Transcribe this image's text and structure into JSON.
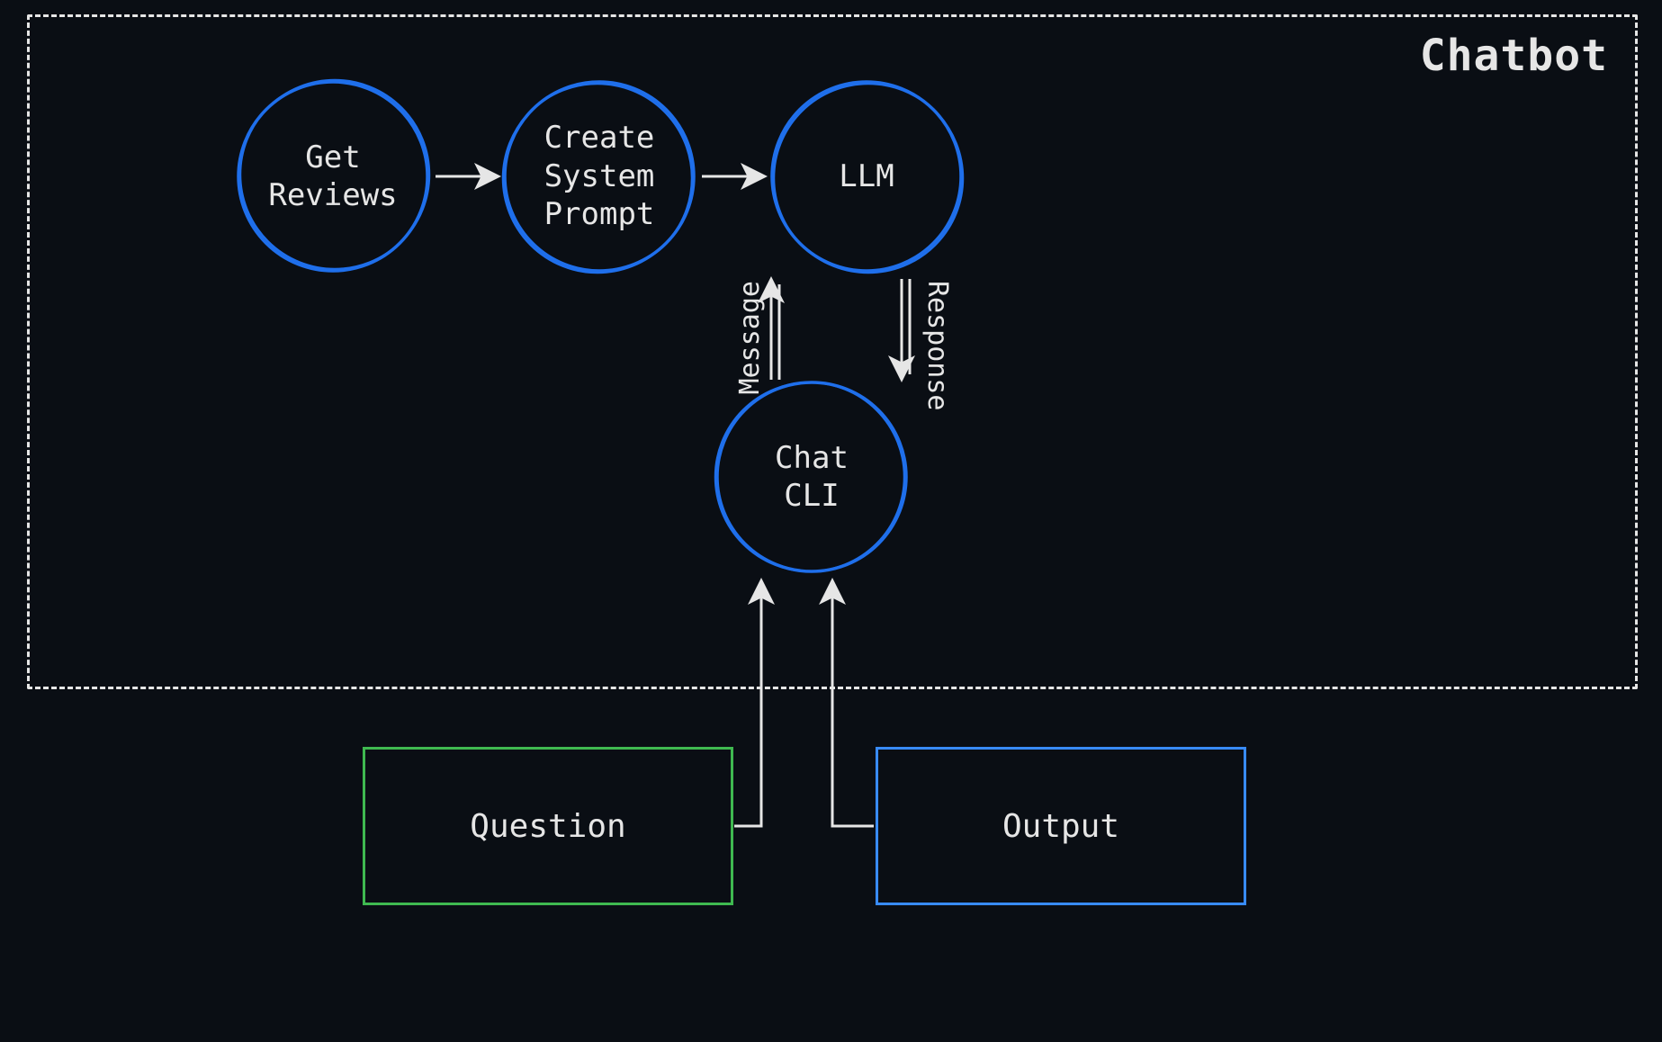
{
  "container": {
    "label": "Chatbot"
  },
  "nodes": {
    "reviews": {
      "label": "Get\nReviews"
    },
    "prompt": {
      "label": "Create\nSystem\nPrompt"
    },
    "llm": {
      "label": "LLM"
    },
    "cli": {
      "label": "Chat\nCLI"
    }
  },
  "rects": {
    "question": {
      "label": "Question"
    },
    "output": {
      "label": "Output"
    }
  },
  "edges": {
    "message": {
      "label": "Message"
    },
    "response": {
      "label": "Response"
    }
  },
  "colors": {
    "bg": "#0a0e14",
    "stroke_light": "#e6e6e6",
    "circle": "#1f6feb",
    "green": "#3fb950",
    "blue": "#388bfd"
  }
}
